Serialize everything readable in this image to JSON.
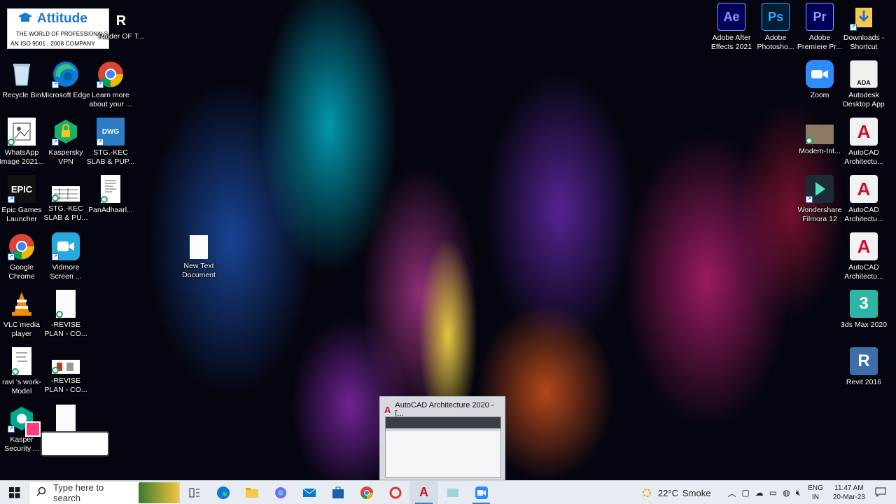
{
  "logo": {
    "name": "Attitude",
    "tagline": "THE WORLD OF PROFESSIONALS",
    "iso": "AN ISO 9001 : 2008 COMPANY"
  },
  "desktop_icons_left": [
    {
      "id": "recycle-bin",
      "label": "Recycle Bin",
      "icon": "recycle-bin-icon"
    },
    {
      "id": "microsoft-edge",
      "label": "Microsoft Edge",
      "icon": "edge-icon"
    },
    {
      "id": "learn-more",
      "label": "Learn more about your ...",
      "icon": "chrome-icon"
    },
    {
      "id": "whatsapp-image",
      "label": "WhatsApp Image 2021...",
      "icon": "image-file-icon"
    },
    {
      "id": "kaspersky-vpn",
      "label": "Kaspersky VPN",
      "icon": "kaspersky-vpn-icon"
    },
    {
      "id": "stg-kec-1",
      "label": "STG.-KEC SLAB & PUP...",
      "icon": "dwg-file-icon"
    },
    {
      "id": "epic-games",
      "label": "Epic Games Launcher",
      "icon": "epic-games-icon"
    },
    {
      "id": "stg-kec-2",
      "label": "STG.-KEC SLAB & PU...",
      "icon": "drawing-thumbnail-icon"
    },
    {
      "id": "panadhaarl",
      "label": "PanAdhaarl...",
      "icon": "document-icon"
    },
    {
      "id": "google-chrome",
      "label": "Google Chrome",
      "icon": "chrome-icon"
    },
    {
      "id": "vidmore",
      "label": "Vidmore Screen ...",
      "icon": "vidmore-icon"
    },
    {
      "id": "vlc",
      "label": "VLC media player",
      "icon": "vlc-cone-icon"
    },
    {
      "id": "revise-1",
      "label": "-REVISE PLAN - CO...",
      "icon": "blank-file-icon"
    },
    {
      "id": "ravis-work",
      "label": "ravi 's work-Model",
      "icon": "drawing-thumbnail-icon"
    },
    {
      "id": "revise-2",
      "label": "-REVISE PLAN - CO...",
      "icon": "drawing-thumbnail-icon"
    },
    {
      "id": "kaspersky-security",
      "label": "Kasper Security ...",
      "icon": "kaspersky-icon"
    },
    {
      "id": "blank-file",
      "label": "",
      "icon": "blank-file-icon"
    },
    {
      "id": "raider",
      "label": "Raider OF T...",
      "icon": "game-icon"
    }
  ],
  "desktop_icons_middle": [
    {
      "id": "new-text-document",
      "label": "New Text Document",
      "icon": "text-file-icon"
    }
  ],
  "desktop_icons_right": [
    {
      "id": "after-effects",
      "label": "Adobe After Effects 2021",
      "icon": "after-effects-icon",
      "glyph": "Ae"
    },
    {
      "id": "photoshop",
      "label": "Adobe Photosho...",
      "icon": "photoshop-icon",
      "glyph": "Ps"
    },
    {
      "id": "premiere",
      "label": "Adobe Premiere Pr...",
      "icon": "premiere-icon",
      "glyph": "Pr"
    },
    {
      "id": "downloads",
      "label": "Downloads - Shortcut",
      "icon": "folder-icon"
    },
    {
      "id": "zoom",
      "label": "Zoom",
      "icon": "zoom-camera-icon"
    },
    {
      "id": "autodesk-desktop",
      "label": "Autodesk Desktop App",
      "icon": "autodesk-ada-icon",
      "glyph": "ADA"
    },
    {
      "id": "modern-int",
      "label": "Modern-Int...",
      "icon": "image-thumbnail-icon"
    },
    {
      "id": "autocad-arch-1",
      "label": "AutoCAD Architectu...",
      "icon": "autocad-icon",
      "glyph": "A"
    },
    {
      "id": "filmora",
      "label": "Wondershare Filmora 12",
      "icon": "filmora-icon"
    },
    {
      "id": "autocad-arch-2",
      "label": "AutoCAD Architectu...",
      "icon": "autocad-icon",
      "glyph": "A"
    },
    {
      "id": "autocad-arch-3",
      "label": "AutoCAD Architectu...",
      "icon": "autocad-icon",
      "glyph": "A"
    },
    {
      "id": "3ds-max",
      "label": "3ds Max 2020",
      "icon": "3ds-max-icon",
      "glyph": "3"
    },
    {
      "id": "revit",
      "label": "Revit 2016",
      "icon": "revit-icon",
      "glyph": "R"
    }
  ],
  "popup": {
    "title": "AutoCAD Architecture 2020 - [..."
  },
  "taskbar": {
    "search_placeholder": "Type here to search",
    "weather_temp": "22°C",
    "weather_desc": "Smoke",
    "lang_top": "ENG",
    "lang_bottom": "IN",
    "time": "11:47 AM",
    "date": "20-Mar-23"
  },
  "colors": {
    "taskbar_bg": "#e7ecf2",
    "accent": "#3b7dd8",
    "autocad_red": "#c8102e"
  }
}
